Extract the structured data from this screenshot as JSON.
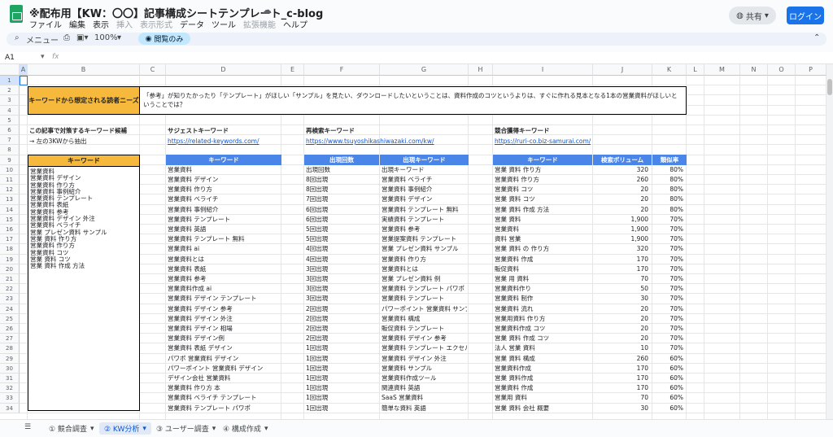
{
  "doc": {
    "title": "※配布用【KW：〇〇】記事構成シートテンプレート_c-blog",
    "menus": [
      "ファイル",
      "編集",
      "表示",
      "挿入",
      "表示形式",
      "データ",
      "ツール",
      "拡張機能",
      "ヘルプ"
    ],
    "share_label": "共有",
    "login_label": "ログイン"
  },
  "toolbar": {
    "menu_label": "メニュー",
    "zoom": "100%",
    "view_only": "閲覧のみ"
  },
  "formula": {
    "cell_ref": "A1",
    "fx": "fx"
  },
  "columns": [
    "A",
    "B",
    "C",
    "D",
    "E",
    "F",
    "G",
    "H",
    "I",
    "J",
    "K",
    "L",
    "M",
    "N",
    "O",
    "P"
  ],
  "rows": [
    "1",
    "2",
    "3",
    "4",
    "5",
    "6",
    "7",
    "8",
    "9",
    "10",
    "11",
    "12",
    "13",
    "14",
    "15",
    "16",
    "17",
    "18",
    "19",
    "20",
    "21",
    "22",
    "23",
    "24",
    "25",
    "26",
    "27",
    "28",
    "29",
    "30",
    "31",
    "32",
    "33",
    "34"
  ],
  "needs": {
    "label": "キーワードから想定される読者ニーズ",
    "text": "「参考」が知りたかったり「テンプレート」がほしい「サンプル」を見たい、ダウンロードしたいということは、資料作成のコツというよりは、すぐに作れる見本となる1本の営業資料がほしいということでは？"
  },
  "target": {
    "title": "この記事で対策するキーワード候補",
    "note": "→ 左の3KWから抽出",
    "header": "キーワード",
    "items": [
      "営業資料",
      "営業資料 デザイン",
      "営業資料 作り方",
      "営業資料 事例紹介",
      "営業資料 テンプレート",
      "営業資料 表紙",
      "営業資料 参考",
      "営業資料 デザイン 外注",
      "営業資料 ベライチ",
      "営業 プレゼン資料 サンプル",
      "営業 資料 作り方",
      "営業資料 作り方",
      "営業資料 コツ",
      "営業 資料 コツ",
      "営業 資料 作成 方法"
    ]
  },
  "suggest": {
    "title": "サジェストキーワード",
    "url": "https://related-keywords.com/",
    "header": "キーワード",
    "items": [
      "営業資料",
      "営業資料 デザイン",
      "営業資料 作り方",
      "営業資料 ベライチ",
      "営業資料 事例紹介",
      "営業資料 テンプレート",
      "営業資料 英語",
      "営業資料 テンプレート 無料",
      "営業資料 ai",
      "営業資料とは",
      "営業資料 表紙",
      "営業資料 参考",
      "営業資料作成 ai",
      "営業資料 デザイン テンプレート",
      "営業資料 デザイン 参考",
      "営業資料 デザイン 外注",
      "営業資料 デザイン 相場",
      "営業資料 デザイン例",
      "営業資料 表紙 デザイン",
      "パワポ 営業資料 デザイン",
      "パワーポイント 営業資料 デザイン",
      "デザイン会社 営業資料",
      "営業資料 作り方 本",
      "営業資料 ベライチ テンプレート",
      "営業資料 テンプレート パワポ"
    ]
  },
  "research": {
    "title": "再検索キーワード",
    "url": "https://www.tsuyoshikashiwazaki.com/kw/",
    "header_count": "出現回数",
    "header_kw": "出現キーワード",
    "counts": [
      "出現回数",
      "8回出現",
      "8回出現",
      "7回出現",
      "6回出現",
      "6回出現",
      "5回出現",
      "5回出現",
      "4回出現",
      "4回出現",
      "3回出現",
      "3回出現",
      "3回出現",
      "3回出現",
      "2回出現",
      "2回出現",
      "2回出現",
      "2回出現",
      "1回出現",
      "1回出現",
      "1回出現",
      "1回出現",
      "1回出現",
      "1回出現",
      "1回出現"
    ],
    "keywords": [
      "出現キーワード",
      "営業資料 ベライチ",
      "営業資料 事例紹介",
      "営業資料 デザイン",
      "営業資料 テンプレート 無料",
      "実績資料 テンプレート",
      "営業資料 参考",
      "営業提案資料 テンプレート",
      "営業 プレゼン資料 サンプル",
      "営業資料 作り方",
      "営業資料とは",
      "営業 プレゼン資料 例",
      "営業資料 テンプレート パワポ",
      "営業資料 テンプレート",
      "パワーポイント 営業資料 サンプル",
      "営業資料 構成",
      "販促資料 テンプレート",
      "営業資料 デザイン 参考",
      "営業資料 テンプレート エクセル",
      "営業資料 デザイン 外注",
      "営業資料 サンプル",
      "営業資料作成ツール",
      "関連資料 英語",
      "SaaS 営業資料",
      "簡単な資料 英語"
    ]
  },
  "competitor": {
    "title": "競合獲得キーワード",
    "url": "https://ruri-co.biz-samurai.com/",
    "header_kw": "キーワード",
    "header_vol": "検索ボリューム",
    "header_sim": "類似率",
    "rows": [
      [
        "営業 資料 作り方",
        "320",
        "80%"
      ],
      [
        "営業資料 作り方",
        "260",
        "80%"
      ],
      [
        "営業資料 コツ",
        "20",
        "80%"
      ],
      [
        "営業 資料 コツ",
        "20",
        "80%"
      ],
      [
        "営業 資料 作成 方法",
        "20",
        "80%"
      ],
      [
        "営業 資料",
        "1,900",
        "70%"
      ],
      [
        "営業資料",
        "1,900",
        "70%"
      ],
      [
        "資料 営業",
        "1,900",
        "70%"
      ],
      [
        "営業 資料 の 作り方",
        "320",
        "70%"
      ],
      [
        "営業資料 作成",
        "170",
        "70%"
      ],
      [
        "販促資料",
        "170",
        "70%"
      ],
      [
        "営業 用 資料",
        "70",
        "70%"
      ],
      [
        "営業資料作り",
        "50",
        "70%"
      ],
      [
        "営業資料 制作",
        "30",
        "70%"
      ],
      [
        "営業資料 流れ",
        "20",
        "70%"
      ],
      [
        "営業用資料 作り方",
        "20",
        "70%"
      ],
      [
        "営業資料作成 コツ",
        "20",
        "70%"
      ],
      [
        "営業 資料 作成 コツ",
        "20",
        "70%"
      ],
      [
        "法人 営業 資料",
        "10",
        "70%"
      ],
      [
        "営業 資料 構成",
        "260",
        "60%"
      ],
      [
        "営業資料作成",
        "170",
        "60%"
      ],
      [
        "営業 資料作成",
        "170",
        "60%"
      ],
      [
        "営業資料 作成",
        "170",
        "60%"
      ],
      [
        "営業用 資料",
        "70",
        "60%"
      ],
      [
        "営業 資料 会社 概要",
        "30",
        "60%"
      ]
    ]
  },
  "sheets": [
    "① 競合調査",
    "② KW分析",
    "③ ユーザー調査",
    "④ 構成作成"
  ],
  "active_sheet": 1
}
